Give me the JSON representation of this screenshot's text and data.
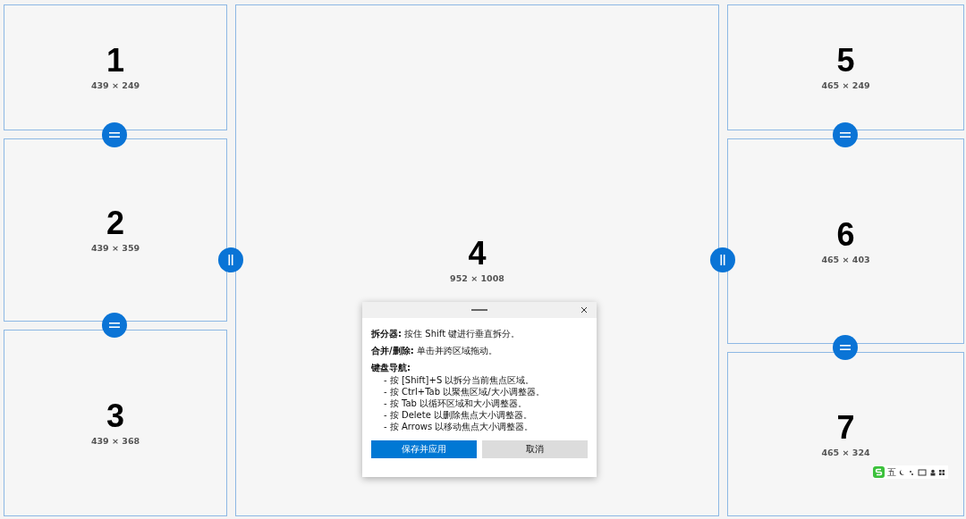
{
  "zones": [
    {
      "number": "1",
      "size": "439 × 249"
    },
    {
      "number": "2",
      "size": "439 × 359"
    },
    {
      "number": "3",
      "size": "439 × 368"
    },
    {
      "number": "4",
      "size": "952 × 1008"
    },
    {
      "number": "5",
      "size": "465 × 249"
    },
    {
      "number": "6",
      "size": "465 × 403"
    },
    {
      "number": "7",
      "size": "465 × 324"
    }
  ],
  "dialog": {
    "lines": [
      {
        "label": "拆分器:",
        "text": "按住 Shift 键进行垂直拆分。"
      },
      {
        "label": "合并/删除:",
        "text": "单击并跨区域拖动。"
      }
    ],
    "list_title": "键盘导航:",
    "bullets": [
      "- 按 [Shift]+S 以拆分当前焦点区域。",
      "- 按 Ctrl+Tab 以聚焦区域/大小调整器。",
      "- 按 Tab 以循环区域和大小调整器。",
      "- 按 Delete 以删除焦点大小调整器。",
      "- 按 Arrows 以移动焦点大小调整器。"
    ],
    "buttons": [
      {
        "label": "保存并应用",
        "kind": "primary"
      },
      {
        "label": "取消",
        "kind": "secondary"
      }
    ]
  },
  "ime_bar": {
    "mode": "五"
  }
}
